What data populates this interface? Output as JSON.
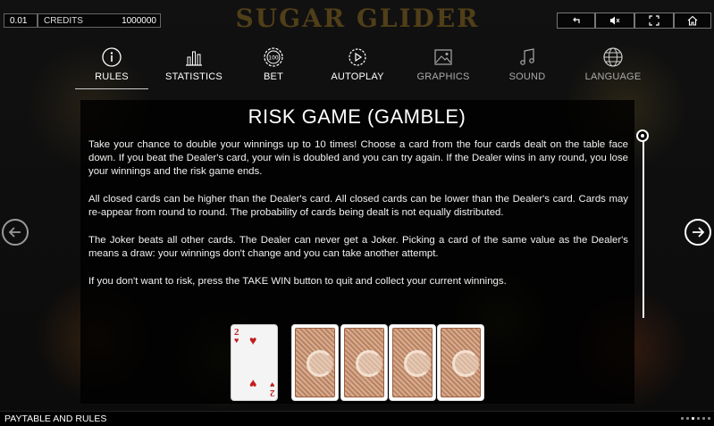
{
  "game_logo": "SUGAR GLIDER",
  "topbar": {
    "bet_value": "0.01",
    "credits_label": "CREDITS",
    "credits_value": "1000000"
  },
  "controls": {
    "back_icon": "undo-arrow-icon",
    "sound_icon": "speaker-mute-icon",
    "fullscreen_icon": "fullscreen-icon",
    "home_icon": "home-icon"
  },
  "tabs": [
    {
      "label": "RULES",
      "icon": "info-icon",
      "active": true
    },
    {
      "label": "STATISTICS",
      "icon": "bar-chart-icon",
      "active": false
    },
    {
      "label": "BET",
      "icon": "chip-100-icon",
      "active": false
    },
    {
      "label": "AUTOPLAY",
      "icon": "autoplay-icon",
      "active": false
    },
    {
      "label": "GRAPHICS",
      "icon": "image-icon",
      "active": false
    },
    {
      "label": "SOUND",
      "icon": "music-note-icon",
      "active": false
    },
    {
      "label": "LANGUAGE",
      "icon": "globe-icon",
      "active": false
    }
  ],
  "content": {
    "title": "RISK GAME (GAMBLE)",
    "paragraphs": [
      "Take your chance to double your winnings up to 10 times! Choose a card from the four cards dealt on the table face down. If you beat the Dealer's card, your win is doubled and you can try again. If the Dealer wins in any round, you lose your winnings and the risk game ends.",
      "All closed cards can be higher than the Dealer's card. All closed cards can be lower than the Dealer's card. Cards may re-appear from round to round. The probability of cards being dealt is not equally distributed.",
      "The Joker beats all other cards. The Dealer can never get a Joker. Picking a card of the same value as the Dealer's means a draw: your winnings don't change and you can take another attempt.",
      "If you don't want to risk, press the TAKE WIN button to quit and collect your current winnings."
    ]
  },
  "cards": {
    "dealer_rank": "2",
    "dealer_suit": "♥",
    "closed_count": 4
  },
  "bottom": {
    "label": "PAYTABLE AND RULES",
    "page_dots": 6,
    "active_dot": 2
  },
  "colors": {
    "panel_bg": "#000000",
    "text": "#ffffff",
    "card_back": "#b98263",
    "heart_red": "#c31b1b"
  }
}
